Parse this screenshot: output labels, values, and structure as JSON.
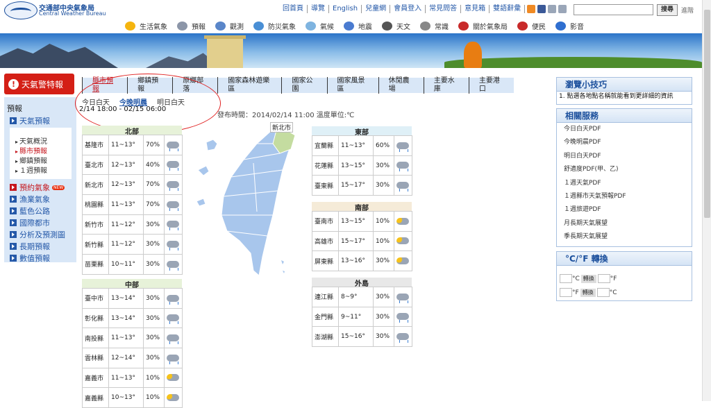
{
  "header": {
    "logo_zh": "交通部中央氣象局",
    "logo_en": "Central Weather Bureau",
    "top_links": [
      "回首頁",
      "導覽",
      "English",
      "兒童網",
      "會員登入",
      "常見問答",
      "意見箱",
      "雙語辭彙"
    ],
    "search_button": "搜尋",
    "advanced": "進階",
    "nav": [
      {
        "label": "生活氣象",
        "icon": "sun-icon",
        "color": "#f5b50f"
      },
      {
        "label": "預報",
        "icon": "plane-icon",
        "color": "#8c96a8"
      },
      {
        "label": "觀測",
        "icon": "observe-icon",
        "color": "#5a86c9"
      },
      {
        "label": "防災氣象",
        "icon": "disaster-icon",
        "color": "#4a8fd5"
      },
      {
        "label": "氣候",
        "icon": "climate-icon",
        "color": "#7fb4e0"
      },
      {
        "label": "地震",
        "icon": "quake-icon",
        "color": "#4a7bd0"
      },
      {
        "label": "天文",
        "icon": "telescope-icon",
        "color": "#555"
      },
      {
        "label": "常識",
        "icon": "magnifier-icon",
        "color": "#888"
      },
      {
        "label": "關於氣象局",
        "icon": "person-icon",
        "color": "#c82a2a"
      },
      {
        "label": "便民",
        "icon": "service-icon",
        "color": "#c82a2a"
      },
      {
        "label": "影音",
        "icon": "video-icon",
        "color": "#2f6fd0"
      }
    ]
  },
  "sidebar": {
    "warning": "天氣警特報",
    "title": "預報",
    "forecast": "天氣預報",
    "sub": [
      "天氣概況",
      "縣市預報",
      "鄉鎮預報",
      "１週預報"
    ],
    "items": [
      "預約氣象",
      "漁業氣象",
      "藍色公路",
      "國際都市",
      "分析及預測圖",
      "長期預報",
      "數值預報"
    ],
    "new_badge": "NEW"
  },
  "tabs": [
    "縣市預報",
    "鄉鎮預報",
    "原鄉部落",
    "國家森林遊樂區",
    "國家公園",
    "國家風景區",
    "休閒農場",
    "主要水庫",
    "主要港口"
  ],
  "period": {
    "options": [
      "今日白天",
      "今晚明晨",
      "明日白天"
    ],
    "range": "2/14 18:00 - 02/15 06:00"
  },
  "issued": "發布時間：2014/02/14 11:00 溫度單位:℃",
  "map_label": "新北市",
  "regions": [
    {
      "name": "北部",
      "rows": [
        {
          "city": "基隆市",
          "temp": "11~13°",
          "rain": "70%",
          "icon": "rain"
        },
        {
          "city": "臺北市",
          "temp": "12~13°",
          "rain": "40%",
          "icon": "rain"
        },
        {
          "city": "新北市",
          "temp": "12~13°",
          "rain": "70%",
          "icon": "rain"
        },
        {
          "city": "桃園縣",
          "temp": "11~13°",
          "rain": "70%",
          "icon": "rain"
        },
        {
          "city": "新竹市",
          "temp": "11~12°",
          "rain": "30%",
          "icon": "rain"
        },
        {
          "city": "新竹縣",
          "temp": "11~12°",
          "rain": "30%",
          "icon": "rain"
        },
        {
          "city": "苗栗縣",
          "temp": "10~11°",
          "rain": "30%",
          "icon": "rain"
        }
      ]
    },
    {
      "name": "中部",
      "rows": [
        {
          "city": "臺中市",
          "temp": "13~14°",
          "rain": "30%",
          "icon": "rain"
        },
        {
          "city": "彰化縣",
          "temp": "13~14°",
          "rain": "30%",
          "icon": "rain"
        },
        {
          "city": "南投縣",
          "temp": "11~13°",
          "rain": "30%",
          "icon": "rain"
        },
        {
          "city": "雲林縣",
          "temp": "12~14°",
          "rain": "30%",
          "icon": "rain"
        },
        {
          "city": "嘉義市",
          "temp": "11~13°",
          "rain": "10%",
          "icon": "cloud"
        },
        {
          "city": "嘉義縣",
          "temp": "10~13°",
          "rain": "10%",
          "icon": "cloud"
        }
      ]
    },
    {
      "name": "東部",
      "rows": [
        {
          "city": "宜蘭縣",
          "temp": "11~13°",
          "rain": "60%",
          "icon": "rain"
        },
        {
          "city": "花蓮縣",
          "temp": "13~15°",
          "rain": "30%",
          "icon": "rain"
        },
        {
          "city": "臺東縣",
          "temp": "15~17°",
          "rain": "30%",
          "icon": "rain"
        }
      ]
    },
    {
      "name": "南部",
      "rows": [
        {
          "city": "臺南市",
          "temp": "13~15°",
          "rain": "10%",
          "icon": "cloud"
        },
        {
          "city": "高雄市",
          "temp": "15~17°",
          "rain": "10%",
          "icon": "cloud"
        },
        {
          "city": "屏東縣",
          "temp": "13~16°",
          "rain": "30%",
          "icon": "cloud"
        }
      ]
    },
    {
      "name": "外島",
      "rows": [
        {
          "city": "連江縣",
          "temp": "8~9°",
          "rain": "30%",
          "icon": "rain"
        },
        {
          "city": "金門縣",
          "temp": "9~11°",
          "rain": "30%",
          "icon": "rain"
        },
        {
          "city": "澎湖縣",
          "temp": "15~16°",
          "rain": "30%",
          "icon": "rain"
        }
      ]
    }
  ],
  "right": {
    "tips_title": "瀏覽小技巧",
    "tip": "1.  點選各地點名稱就能看到更詳細的資訊",
    "services_title": "相關服務",
    "services": [
      "今日白天PDF",
      "今晚明晨PDF",
      "明日白天PDF",
      "舒適度PDF(甲、乙)",
      "１週天氣PDF",
      "１週縣市天氣預報PDF",
      "１週旅遊PDF",
      "月長期天氣展望",
      "季長期天氣展望"
    ],
    "conv_title": "°C/°F 轉換",
    "conv_btn": "轉換",
    "unit_c": "°C",
    "unit_f": "°F"
  }
}
